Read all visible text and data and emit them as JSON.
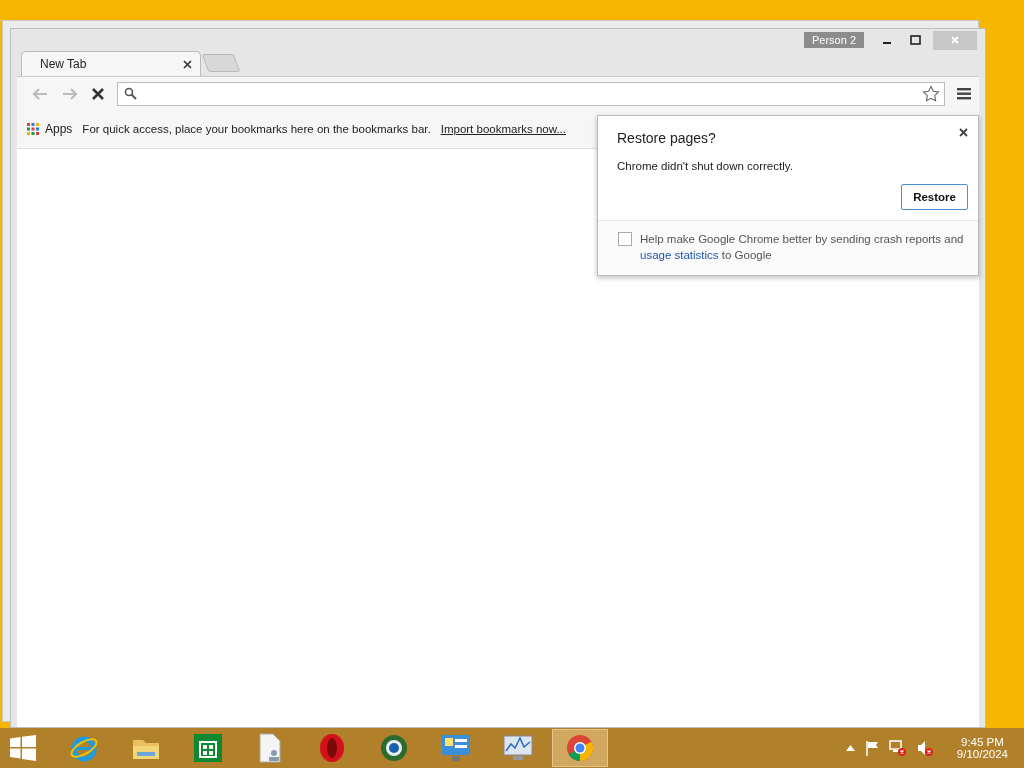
{
  "window": {
    "profile": "Person 2"
  },
  "tabs": [
    {
      "label": "New Tab",
      "selected": true
    }
  ],
  "toolbar": {
    "loading": true
  },
  "bookmarks_bar": {
    "apps": "Apps",
    "hint": "For quick access, place your bookmarks here on the bookmarks bar.",
    "import_link": "Import bookmarks now..."
  },
  "bubble": {
    "title": "Restore pages?",
    "message": "Chrome didn't shut down correctly.",
    "button": "Restore",
    "checkbox": {
      "checked": false,
      "text_before": "Help make Google Chrome better by sending crash reports and ",
      "link": "usage statistics",
      "text_after": " to Google"
    }
  },
  "taskbar": {
    "items": [
      {
        "kind": "ie",
        "selected": false
      },
      {
        "kind": "folder",
        "selected": false
      },
      {
        "kind": "store",
        "selected": false
      },
      {
        "kind": "document",
        "selected": false
      },
      {
        "kind": "opera",
        "selected": false
      },
      {
        "kind": "globe",
        "selected": false
      },
      {
        "kind": "panel",
        "selected": false
      },
      {
        "kind": "monitor",
        "selected": false
      },
      {
        "kind": "chrome",
        "selected": true
      }
    ],
    "clock": {
      "time": "9:45 PM",
      "date": "9/10/2024"
    }
  }
}
